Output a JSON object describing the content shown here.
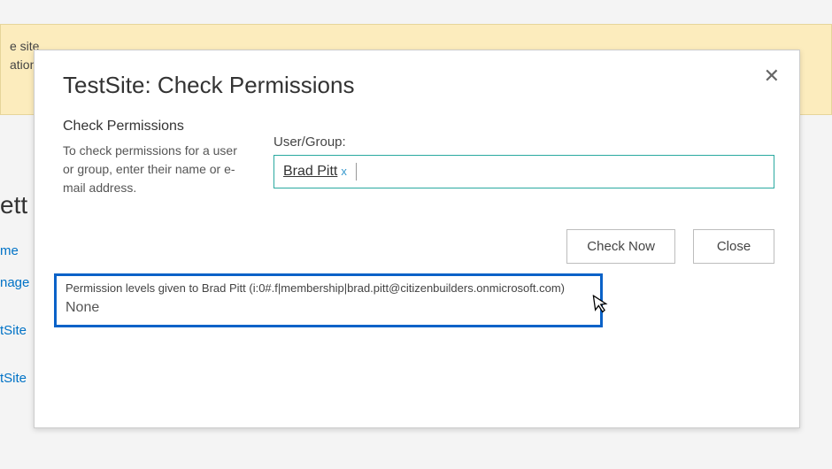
{
  "banner": {
    "line1": "e site",
    "line2": "ation"
  },
  "side": {
    "heading_fragment": "ett",
    "links": [
      "me",
      "nage",
      "tSite",
      "tSite"
    ]
  },
  "dialog": {
    "title": "TestSite: Check Permissions",
    "section_title": "Check Permissions",
    "description": "To check permissions for a user or group, enter their name or e-mail address.",
    "field_label": "User/Group:",
    "chip": {
      "name": "Brad Pitt",
      "remove_label": "x"
    },
    "buttons": {
      "check": "Check Now",
      "close": "Close"
    },
    "result": {
      "heading": "Permission levels given to Brad Pitt (i:0#.f|membership|brad.pitt@citizenbuilders.onmicrosoft.com)",
      "value": "None"
    }
  }
}
